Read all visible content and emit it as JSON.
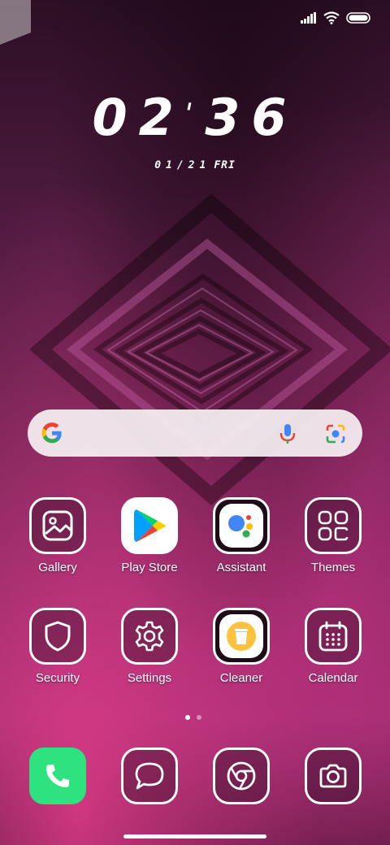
{
  "status_bar": {
    "signal_icon": "signal-icon",
    "wifi_icon": "wifi-icon",
    "battery_icon": "battery-icon"
  },
  "clock": {
    "hours": "02",
    "minutes": "36"
  },
  "date": {
    "text": "01/21",
    "weekday": "FRI"
  },
  "search": {
    "google_icon": "google-g-icon",
    "mic_icon": "mic-icon",
    "lens_icon": "lens-icon"
  },
  "apps": {
    "row1": [
      {
        "label": "Gallery",
        "icon": "gallery-icon"
      },
      {
        "label": "Play Store",
        "icon": "play-store-icon"
      },
      {
        "label": "Assistant",
        "icon": "assistant-icon"
      },
      {
        "label": "Themes",
        "icon": "themes-icon"
      }
    ],
    "row2": [
      {
        "label": "Security",
        "icon": "shield-icon"
      },
      {
        "label": "Settings",
        "icon": "gear-icon"
      },
      {
        "label": "Cleaner",
        "icon": "trash-icon"
      },
      {
        "label": "Calendar",
        "icon": "calendar-icon"
      }
    ]
  },
  "page_indicator": {
    "pages": 2,
    "current": 1
  },
  "dock": [
    {
      "icon": "phone-icon"
    },
    {
      "icon": "messages-icon"
    },
    {
      "icon": "chrome-icon"
    },
    {
      "icon": "camera-icon"
    }
  ],
  "colors": {
    "phone_green": "#2ee37f",
    "accent_pink": "#e63c8c"
  }
}
